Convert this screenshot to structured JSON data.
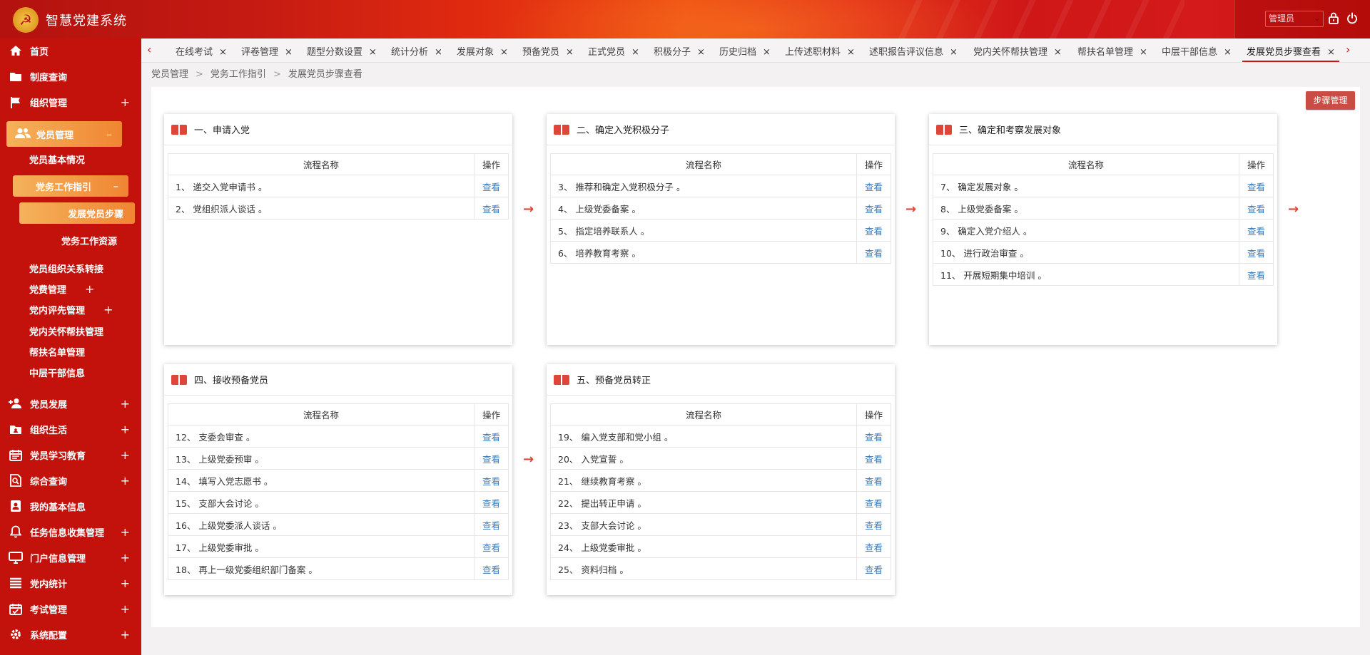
{
  "header": {
    "app_title": "智慧党建系统",
    "role_select": "管理员",
    "colors": {
      "primary": "#c3120c",
      "accent": "#f08533",
      "link": "#3d7ab8"
    },
    "icons": [
      "party-emblem-icon",
      "lock-icon",
      "power-icon"
    ]
  },
  "sidebar": {
    "items": [
      {
        "label": "首页",
        "icon": "home-icon",
        "expandable": false
      },
      {
        "label": "制度查询",
        "icon": "folder-icon",
        "expandable": false
      },
      {
        "label": "组织管理",
        "icon": "flag-icon",
        "expandable": true
      },
      {
        "label": "党员管理",
        "icon": "users-icon",
        "expandable": true,
        "expanded": true
      }
    ],
    "member_sub": [
      {
        "label": "党员基本情况"
      },
      {
        "label": "党务工作指引",
        "expanded": true
      },
      {
        "label": "发展党员步骤",
        "active": true
      },
      {
        "label": "党务工作资源"
      },
      {
        "label": "党员组织关系转接"
      },
      {
        "label": "党费管理",
        "expandable": true
      },
      {
        "label": "党内评先管理",
        "expandable": true
      },
      {
        "label": "党内关怀帮扶管理"
      },
      {
        "label": "帮扶名单管理"
      },
      {
        "label": "中层干部信息"
      }
    ],
    "items_bottom": [
      {
        "label": "党员发展",
        "icon": "user-add-icon",
        "expandable": true
      },
      {
        "label": "组织生活",
        "icon": "id-folder-icon",
        "expandable": true
      },
      {
        "label": "党员学习教育",
        "icon": "calendar-icon",
        "expandable": true
      },
      {
        "label": "综合查询",
        "icon": "search-doc-icon",
        "expandable": true
      },
      {
        "label": "我的基本信息",
        "icon": "profile-icon",
        "expandable": false
      },
      {
        "label": "任务信息收集管理",
        "icon": "bell-icon",
        "expandable": true
      },
      {
        "label": "门户信息管理",
        "icon": "monitor-icon",
        "expandable": true
      },
      {
        "label": "党内统计",
        "icon": "list-icon",
        "expandable": true
      },
      {
        "label": "考试管理",
        "icon": "calendar-check-icon",
        "expandable": true
      },
      {
        "label": "系统配置",
        "icon": "gear-icon",
        "expandable": true
      }
    ]
  },
  "tabs": [
    {
      "label": "在线考试"
    },
    {
      "label": "评卷管理"
    },
    {
      "label": "题型分数设置"
    },
    {
      "label": "统计分析"
    },
    {
      "label": "发展对象"
    },
    {
      "label": "预备党员"
    },
    {
      "label": "正式党员"
    },
    {
      "label": "积极分子"
    },
    {
      "label": "历史归档"
    },
    {
      "label": "上传述职材料"
    },
    {
      "label": "述职报告评议信息"
    },
    {
      "label": "党内关怀帮扶管理"
    },
    {
      "label": "帮扶名单管理"
    },
    {
      "label": "中层干部信息"
    },
    {
      "label": "发展党员步骤查看",
      "active": true
    }
  ],
  "breadcrumb": [
    "党员管理",
    "党务工作指引",
    "发展党员步骤查看"
  ],
  "main": {
    "step_manage_label": "步骤管理",
    "col_name": "流程名称",
    "col_op": "操作",
    "view_label": "查看",
    "cards": [
      {
        "title": "一、申请入党",
        "rows": [
          "1、 递交入党申请书 。",
          "2、 党组织派人谈话 。"
        ]
      },
      {
        "title": "二、确定入党积极分子",
        "rows": [
          "3、 推荐和确定入党积极分子 。",
          "4、 上级党委备案 。",
          "5、 指定培养联系人 。",
          "6、 培养教育考察 。"
        ]
      },
      {
        "title": "三、确定和考察发展对象",
        "rows": [
          "7、 确定发展对象 。",
          "8、 上级党委备案 。",
          "9、 确定入党介绍人 。",
          "10、 进行政治审查 。",
          "11、 开展短期集中培训 。"
        ]
      },
      {
        "title": "四、接收预备党员",
        "rows": [
          "12、 支委会审查 。",
          "13、 上级党委预审 。",
          "14、 填写入党志愿书 。",
          "15、 支部大会讨论 。",
          "16、 上级党委派人谈话 。",
          "17、 上级党委审批 。",
          "18、 再上一级党委组织部门备案 。"
        ]
      },
      {
        "title": "五、预备党员转正",
        "rows": [
          "19、 编入党支部和党小组 。",
          "20、 入党宣誓 。",
          "21、 继续教育考察 。",
          "22、 提出转正申请 。",
          "23、 支部大会讨论 。",
          "24、 上级党委审批 。",
          "25、 资料归档 。"
        ]
      }
    ]
  }
}
